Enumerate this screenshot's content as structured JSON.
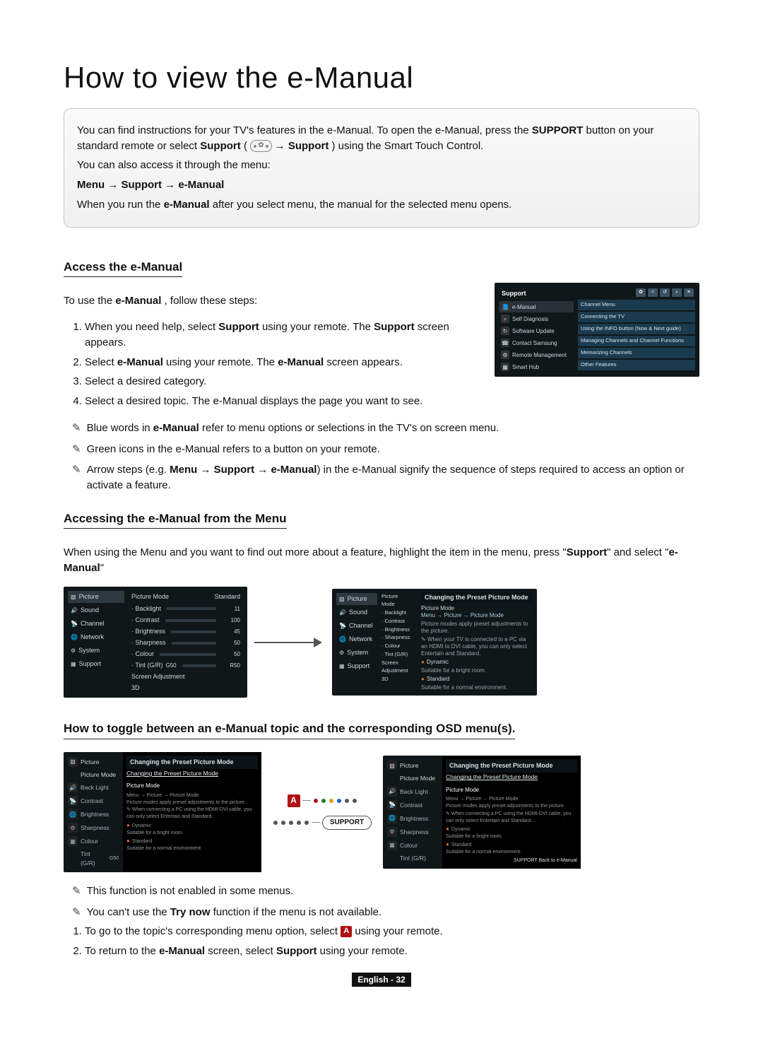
{
  "page_title": "How to view the e-Manual",
  "intro": {
    "p1_prefix": "You can find instructions for your TV's features in the e-Manual. To open the e-Manual, press the ",
    "p1_bold1": "SUPPORT",
    "p1_mid1": " button on your standard remote or select ",
    "p1_bold2": "Support",
    "p1_mid2": " (",
    "p1_mid3": " → ",
    "p1_bold3": "Support",
    "p1_tail": ") using the Smart Touch Control.",
    "p2": "You can also access it through the menu:",
    "path": "Menu → Support → e-Manual",
    "p3_prefix": "When you run the ",
    "p3_bold": "e-Manual",
    "p3_tail": " after you select menu, the manual for the selected menu opens."
  },
  "access": {
    "title": "Access the e-Manual",
    "lead_prefix": "To use the ",
    "lead_bold": "e-Manual",
    "lead_tail": ", follow these steps:",
    "steps": {
      "s1a": "When you need help, select ",
      "s1b": "Support",
      "s1c": " using your remote. The ",
      "s1d": "Support",
      "s1e": " screen appears.",
      "s2a": "Select ",
      "s2b": "e-Manual",
      "s2c": " using your remote. The ",
      "s2d": "e-Manual",
      "s2e": " screen appears.",
      "s3": "Select a desired category.",
      "s4": "Select a desired topic. The e-Manual displays the page you want to see."
    },
    "notes": {
      "n1a": "Blue words in ",
      "n1b": "e-Manual",
      "n1c": " refer to menu options or selections in the TV's on screen menu.",
      "n2": "Green icons in the e-Manual refers to a button on your remote.",
      "n3a": "Arrow steps (e.g. ",
      "n3b": "Menu → Support → e-Manual",
      "n3c": ") in the e-Manual signify the sequence of steps required to access an option or activate a feature."
    }
  },
  "from_menu": {
    "title": "Accessing the e-Manual from the Menu",
    "p_a": "When using the Menu and you want to find out more about a feature, highlight the item in the menu, press \"",
    "p_b": "Support",
    "p_c": "\" and select \"",
    "p_d": "e-Manual",
    "p_e": "\""
  },
  "toggle": {
    "title": "How to toggle between an e-Manual topic and the corresponding OSD menu(s).",
    "notes": {
      "n1": "This function is not enabled in some menus.",
      "n2a": "You can't use the ",
      "n2b": "Try now",
      "n2c": " function if the menu is not available."
    },
    "steps": {
      "s1a": "To go to the topic's corresponding menu option, select ",
      "s1b": " using your remote.",
      "s2a": "To return to the ",
      "s2b": "e-Manual",
      "s2c": " screen, select ",
      "s2d": "Support",
      "s2e": " using your remote."
    }
  },
  "footer": "English - 32",
  "support_shot": {
    "header": "Support",
    "items": [
      "e-Manual",
      "Self Diagnosis",
      "Software Update",
      "Contact Samsung",
      "Remote Management",
      "Smart Hub"
    ],
    "right_items": [
      "Channel Menu",
      "Connecting the TV",
      "Using the INFO button (Now & Next guide)",
      "Managing Channels and Channel Functions",
      "Memorizing Channels",
      "Other Features"
    ]
  },
  "tv_menu": {
    "sidebar": [
      "Picture",
      "Sound",
      "Channel",
      "Network",
      "System",
      "Support"
    ],
    "panel_head_left": "Picture Mode",
    "panel_head_right": "Standard",
    "rows": {
      "backlight": {
        "label": "· Backlight",
        "val": "11"
      },
      "contrast": {
        "label": "· Contrast",
        "val": "100"
      },
      "brightness": {
        "label": "· Brightness",
        "val": "45"
      },
      "sharpness": {
        "label": "· Sharpness",
        "val": "50"
      },
      "colour": {
        "label": "· Colour",
        "val": "50"
      },
      "tint": {
        "label": "· Tint (G/R)",
        "mid": "G50",
        "val": "R50"
      },
      "screenadj": {
        "label": "Screen Adjustment"
      },
      "threeD": {
        "label": "3D"
      }
    }
  },
  "emanual_panel": {
    "head": "Changing the Preset Picture Mode",
    "subhead": "Picture Mode",
    "path": "Menu → Picture → Picture Mode",
    "line1": "Picture modes apply preset adjustments to the picture.",
    "line2": "✎ When your TV is connected to a PC via an HDMI to DVI cable, you can only select Entertain and Standard.",
    "items": {
      "dyn": {
        "label": "Dynamic",
        "desc": ""
      },
      "std": {
        "label": "Standard",
        "desc": "Suitable for a bright room."
      },
      "nat": {
        "label": "",
        "desc": "Suitable for a normal environment."
      }
    }
  },
  "osd": {
    "head": "Changing the Preset Picture Mode",
    "link": "Changing the Preset Picture Mode",
    "pm": "Picture Mode",
    "pm_sub": "Menu → Picture → Picture Mode",
    "tiny1": "Picture modes apply preset adjustments to the picture.",
    "tiny2": "✎ When connecting a PC using the HDMI-DVI cable, you can only select Entertain and Standard.",
    "b1": "Dynamic",
    "b1d": "Suitable for a bright room.",
    "b2": "Standard",
    "b2d": "Suitable for a normal environment.",
    "back": "SUPPORT  Back to e-Manual",
    "sidebar": [
      "Picture",
      "Picture Mode",
      "Back Light",
      "Contrast",
      "Brightness",
      "Sharpness",
      "Colour",
      "Tint (G/R)"
    ],
    "tint_val": "G50"
  },
  "remote": {
    "a": "A",
    "support": "SUPPORT"
  }
}
